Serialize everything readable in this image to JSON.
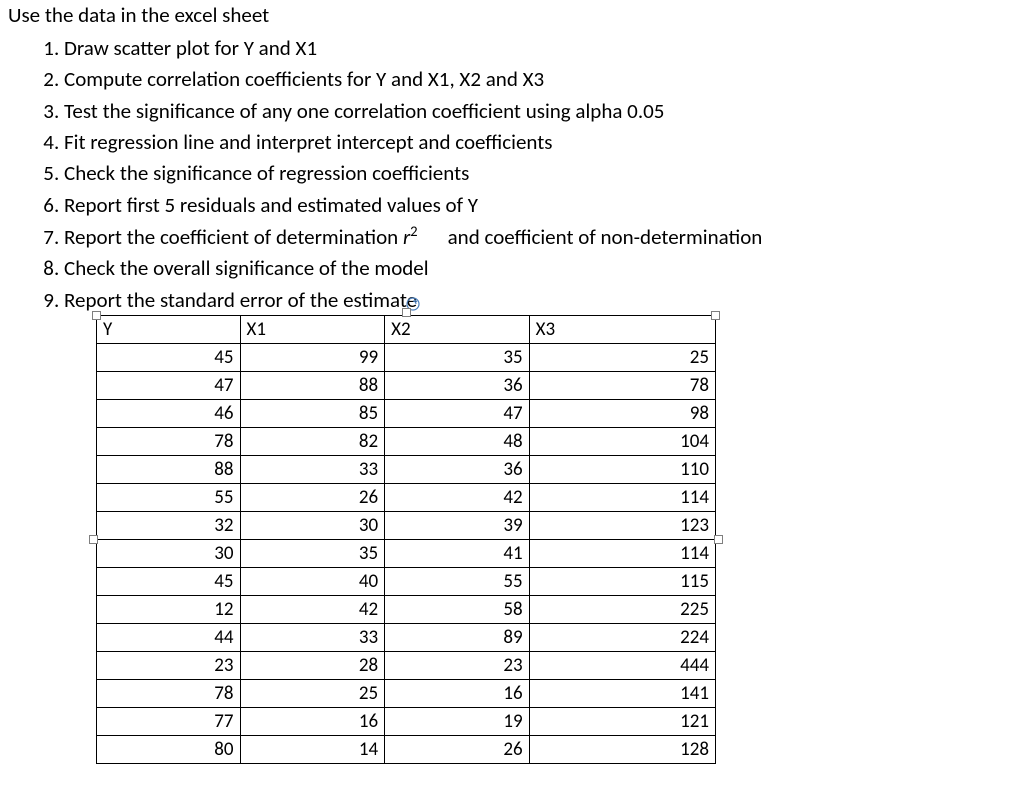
{
  "intro": "Use the data in the excel sheet",
  "items": [
    "Draw scatter plot for Y and X1",
    "Compute correlation coefficients for Y and X1, X2 and X3",
    "Test the significance of any one correlation coefficient using alpha 0.05",
    "Fit regression line and interpret intercept and coefficients",
    "Check the significance of regression coefficients",
    "Report first 5 residuals and estimated values of Y",
    "Report the coefficient of determination ",
    "Check the overall significance of the model",
    "Report the standard error of the estimate"
  ],
  "item7_r2_text": "r",
  "item7_r2_sup": "2",
  "item7_tail": "and coefficient of non-determination",
  "table": {
    "headers": [
      "Y",
      "X1",
      "X2",
      "X3"
    ],
    "rows": [
      [
        45,
        99,
        35,
        25
      ],
      [
        47,
        88,
        36,
        78
      ],
      [
        46,
        85,
        47,
        98
      ],
      [
        78,
        82,
        48,
        104
      ],
      [
        88,
        33,
        36,
        110
      ],
      [
        55,
        26,
        42,
        114
      ],
      [
        32,
        30,
        39,
        123
      ],
      [
        30,
        35,
        41,
        114
      ],
      [
        45,
        40,
        55,
        115
      ],
      [
        12,
        42,
        58,
        225
      ],
      [
        44,
        33,
        89,
        224
      ],
      [
        23,
        28,
        23,
        444
      ],
      [
        78,
        25,
        16,
        141
      ],
      [
        77,
        16,
        19,
        121
      ],
      [
        80,
        14,
        26,
        128
      ]
    ]
  },
  "chart_data": {
    "type": "table",
    "title": "Regression dataset",
    "columns": [
      "Y",
      "X1",
      "X2",
      "X3"
    ],
    "rows": [
      [
        45,
        99,
        35,
        25
      ],
      [
        47,
        88,
        36,
        78
      ],
      [
        46,
        85,
        47,
        98
      ],
      [
        78,
        82,
        48,
        104
      ],
      [
        88,
        33,
        36,
        110
      ],
      [
        55,
        26,
        42,
        114
      ],
      [
        32,
        30,
        39,
        123
      ],
      [
        30,
        35,
        41,
        114
      ],
      [
        45,
        40,
        55,
        115
      ],
      [
        12,
        42,
        58,
        225
      ],
      [
        44,
        33,
        89,
        224
      ],
      [
        23,
        28,
        23,
        444
      ],
      [
        78,
        25,
        16,
        141
      ],
      [
        77,
        16,
        19,
        121
      ],
      [
        80,
        14,
        26,
        128
      ]
    ]
  }
}
